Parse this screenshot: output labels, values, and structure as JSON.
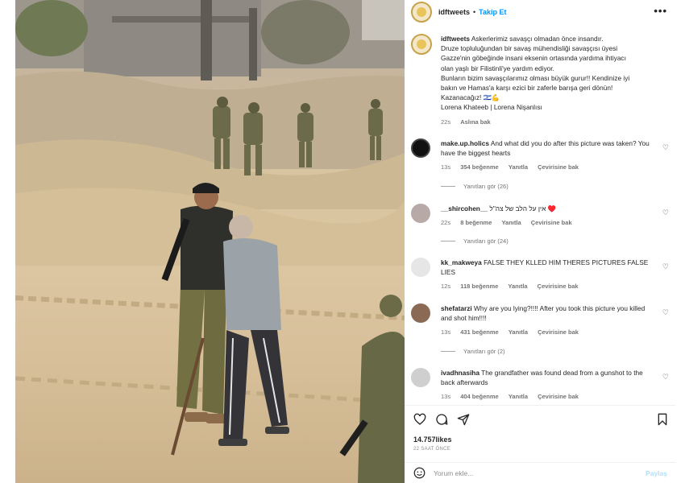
{
  "post": {
    "username": "idftweets",
    "follow_label": "Takip Et",
    "dot": "•",
    "more_icon": "more-horizontal-icon"
  },
  "caption": {
    "username": "idftweets",
    "lines": [
      "Askerlerimiz savaşçı olmadan önce insandır.",
      "Druze topluluğundan bir savaş mühendisliği savaşçısı üyesi",
      "Gazze'nin göbeğinde insani eksenin ortasında yardıma ihtiyacı",
      "olan yaşlı bir Filistinli'ye yardım ediyor.",
      "Bunların bizim savaşçılarımız olması büyük gurur!! Kendinize iyi",
      "bakın ve Hamas'a karşı ezici bir zaferle barışa geri dönün!",
      "Kazanacağız! 🇮🇱💪",
      "Lorena Khateeb | Lorena Nişanlısı"
    ],
    "time": "22s",
    "see_translation": "Aslına bak"
  },
  "comments": [
    {
      "username": "make.up.holics",
      "text": "And what did you do after this picture was taken? You have the biggest hearts",
      "time": "13s",
      "likes": "354 beğenme",
      "reply": "Yanıtla",
      "translate": "Çevirisine bak",
      "replies": "Yanıtları gör (26)"
    },
    {
      "username": "__shircohen__",
      "text": "אין על הלב של צה\"ל ♥️",
      "time": "22s",
      "likes": "8 beğenme",
      "reply": "Yanıtla",
      "translate": "Çevirisine bak",
      "replies": "Yanıtları gör (24)"
    },
    {
      "username": "kk_makweya",
      "text": "FALSE THEY KLLED HIM THERES PICTURES FALSE LIES",
      "time": "12s",
      "likes": "118 beğenme",
      "reply": "Yanıtla",
      "translate": "Çevirisine bak",
      "replies": ""
    },
    {
      "username": "shefatarzi",
      "text": "Why are you lying?!!!! After you took this picture you killed and shot him!!!!",
      "time": "13s",
      "likes": "431 beğenme",
      "reply": "Yanıtla",
      "translate": "Çevirisine bak",
      "replies": "Yanıtları gör (2)"
    },
    {
      "username": "ivadhnasiha",
      "text": "The grandfather was found dead from a gunshot to the back afterwards",
      "time": "13s",
      "likes": "404 beğenme",
      "reply": "Yanıtla",
      "translate": "Çevirisine bak",
      "replies": ""
    }
  ],
  "footer": {
    "likes": "14.757likes",
    "when": "22 SAAT ÖNCE",
    "comment_placeholder": "Yorum ekle...",
    "post_label": "Paylaş"
  },
  "icons": {
    "like": "heart-icon",
    "comment": "comment-icon",
    "share": "share-icon",
    "save": "bookmark-icon",
    "emoji": "emoji-icon",
    "comment_like": "heart-icon"
  },
  "colors": {
    "link": "#0095f6",
    "muted": "#737373",
    "text": "#262626",
    "post_disabled": "#b2dffc"
  }
}
